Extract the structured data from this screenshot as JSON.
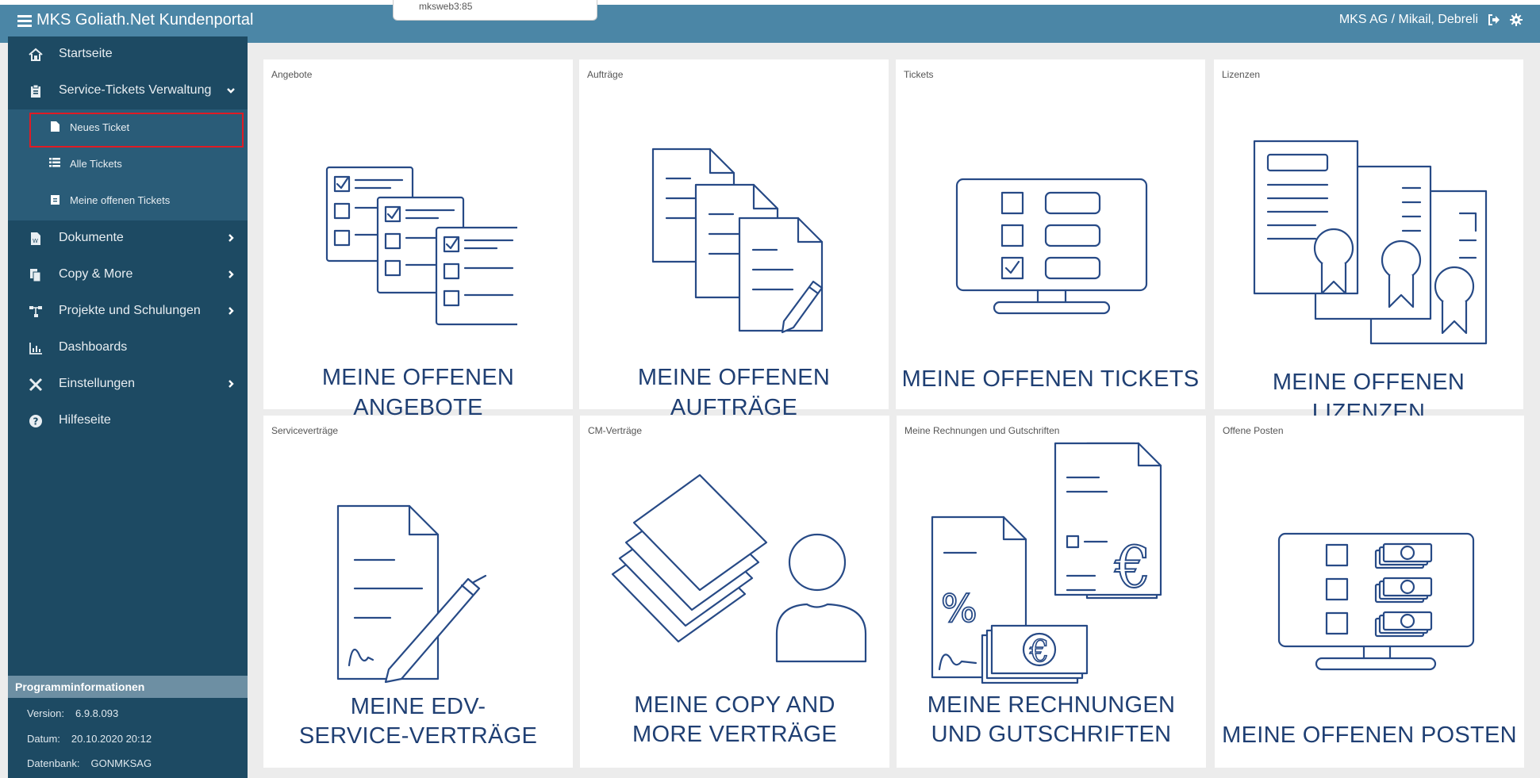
{
  "app": {
    "title": "MKS Goliath.Net Kundenportal",
    "server_popup": "mksweb3:85"
  },
  "user": {
    "label": "MKS AG / Mikail, Debreli"
  },
  "sidebar": {
    "items": [
      {
        "label": "Startseite",
        "icon": "home-icon"
      },
      {
        "label": "Service-Tickets Verwaltung",
        "icon": "clipboard-icon"
      },
      {
        "label": "Dokumente",
        "icon": "file-word-icon"
      },
      {
        "label": "Copy & More",
        "icon": "copy-icon"
      },
      {
        "label": "Projekte und Schulungen",
        "icon": "sitemap-icon"
      },
      {
        "label": "Dashboards",
        "icon": "chart-icon"
      },
      {
        "label": "Einstellungen",
        "icon": "tools-icon"
      },
      {
        "label": "Hilfeseite",
        "icon": "question-icon"
      }
    ],
    "subitems": [
      {
        "label": "Neues Ticket",
        "icon": "file-icon"
      },
      {
        "label": "Alle Tickets",
        "icon": "list-icon"
      },
      {
        "label": "Meine offenen Tickets",
        "icon": "clipboard-small-icon"
      }
    ],
    "info": {
      "heading": "Programminformationen",
      "version_label": "Version:",
      "version_value": "6.9.8.093",
      "date_label": "Datum:",
      "date_value": "20.10.2020 20:12",
      "db_label": "Datenbank:",
      "db_value": "GONMKSAG"
    }
  },
  "tiles": [
    {
      "caption": "Angebote",
      "line1": "MEINE OFFENEN ANGEBOTE",
      "line2": ""
    },
    {
      "caption": "Aufträge",
      "line1": "MEINE OFFENEN AUFTRÄGE",
      "line2": ""
    },
    {
      "caption": "Tickets",
      "line1": "MEINE OFFENEN TICKETS",
      "line2": ""
    },
    {
      "caption": "Lizenzen",
      "line1": "MEINE OFFENEN LIZENZEN",
      "line2": ""
    },
    {
      "caption": "Serviceverträge",
      "line1": "MEINE EDV-",
      "line2": "SERVICE-VERTRÄGE"
    },
    {
      "caption": "CM-Verträge",
      "line1": "MEINE COPY AND",
      "line2": "MORE VERTRÄGE"
    },
    {
      "caption": "Meine Rechnungen und Gutschriften",
      "line1": "MEINE RECHNUNGEN",
      "line2": "UND GUTSCHRIFTEN"
    },
    {
      "caption": "Offene Posten",
      "line1": "MEINE OFFENEN POSTEN",
      "line2": ""
    }
  ],
  "colors": {
    "topbar": "#4b86a6",
    "sidebar": "#1d4a63",
    "submenu": "#2a5c78",
    "tile_text": "#1f3f73",
    "highlight": "#e01b24"
  }
}
